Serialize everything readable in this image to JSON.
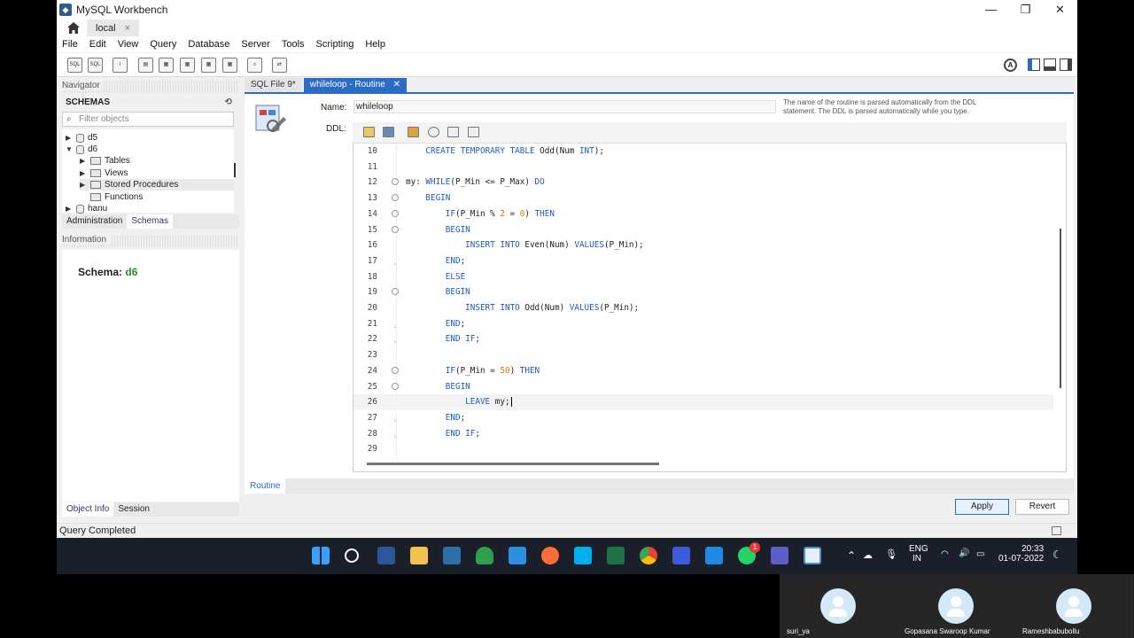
{
  "window": {
    "title": "MySQL Workbench",
    "controls": [
      "minimize-icon",
      "restore-icon",
      "close-icon"
    ]
  },
  "connection_tab": {
    "label": "local",
    "close": "×"
  },
  "menu": [
    "File",
    "Edit",
    "View",
    "Query",
    "Database",
    "Server",
    "Tools",
    "Scripting",
    "Help"
  ],
  "navigator": {
    "header": "Navigator",
    "schemas_label": "SCHEMAS",
    "filter_placeholder": "Filter objects",
    "tree": [
      "d5",
      "d6",
      "Tables",
      "Views",
      "Stored Procedures",
      "Functions",
      "hanu"
    ],
    "tabs": [
      "Administration",
      "Schemas"
    ],
    "info_header": "Information",
    "schema_label": "Schema:",
    "schema_value": "d6",
    "bottom_tabs": [
      "Object Info",
      "Session"
    ]
  },
  "editor_tabs": [
    "SQL File 9*",
    "whileloop - Routine"
  ],
  "routine": {
    "name_label": "Name:",
    "name_value": "whileloop",
    "hint": "The name of the routine is parsed automatically from the DDL statement. The DDL is parsed automatically while you type.",
    "ddl_label": "DDL:",
    "bottom_tab": "Routine",
    "apply": "Apply",
    "revert": "Revert"
  },
  "code_lines": [
    {
      "n": "10",
      "text": "    CREATE TEMPORARY TABLE Odd(Num INT);"
    },
    {
      "n": "11",
      "text": ""
    },
    {
      "n": "12",
      "text": "my: WHILE(P_Min <= P_Max) DO"
    },
    {
      "n": "13",
      "text": "    BEGIN"
    },
    {
      "n": "14",
      "text": "        IF(P_Min % 2 = 0) THEN"
    },
    {
      "n": "15",
      "text": "        BEGIN"
    },
    {
      "n": "16",
      "text": "            INSERT INTO Even(Num) VALUES(P_Min);"
    },
    {
      "n": "17",
      "text": "        END;"
    },
    {
      "n": "18",
      "text": "        ELSE"
    },
    {
      "n": "19",
      "text": "        BEGIN"
    },
    {
      "n": "20",
      "text": "            INSERT INTO Odd(Num) VALUES(P_Min);"
    },
    {
      "n": "21",
      "text": "        END;"
    },
    {
      "n": "22",
      "text": "        END IF;"
    },
    {
      "n": "23",
      "text": ""
    },
    {
      "n": "24",
      "text": "        IF(P_Min = 50) THEN"
    },
    {
      "n": "25",
      "text": "        BEGIN"
    },
    {
      "n": "26",
      "text": "            LEAVE my;"
    },
    {
      "n": "27",
      "text": "        END;"
    },
    {
      "n": "28",
      "text": "        END IF;"
    },
    {
      "n": "29",
      "text": ""
    }
  ],
  "status": "Query Completed",
  "taskbar": {
    "lang1": "ENG",
    "lang2": "IN",
    "time": "20:33",
    "date": "01-07-2022",
    "whatsapp_badge": "1"
  },
  "participants": [
    "suri_ya",
    "Gopasana Swaroop Kumar",
    "Rameshbabubollu"
  ]
}
